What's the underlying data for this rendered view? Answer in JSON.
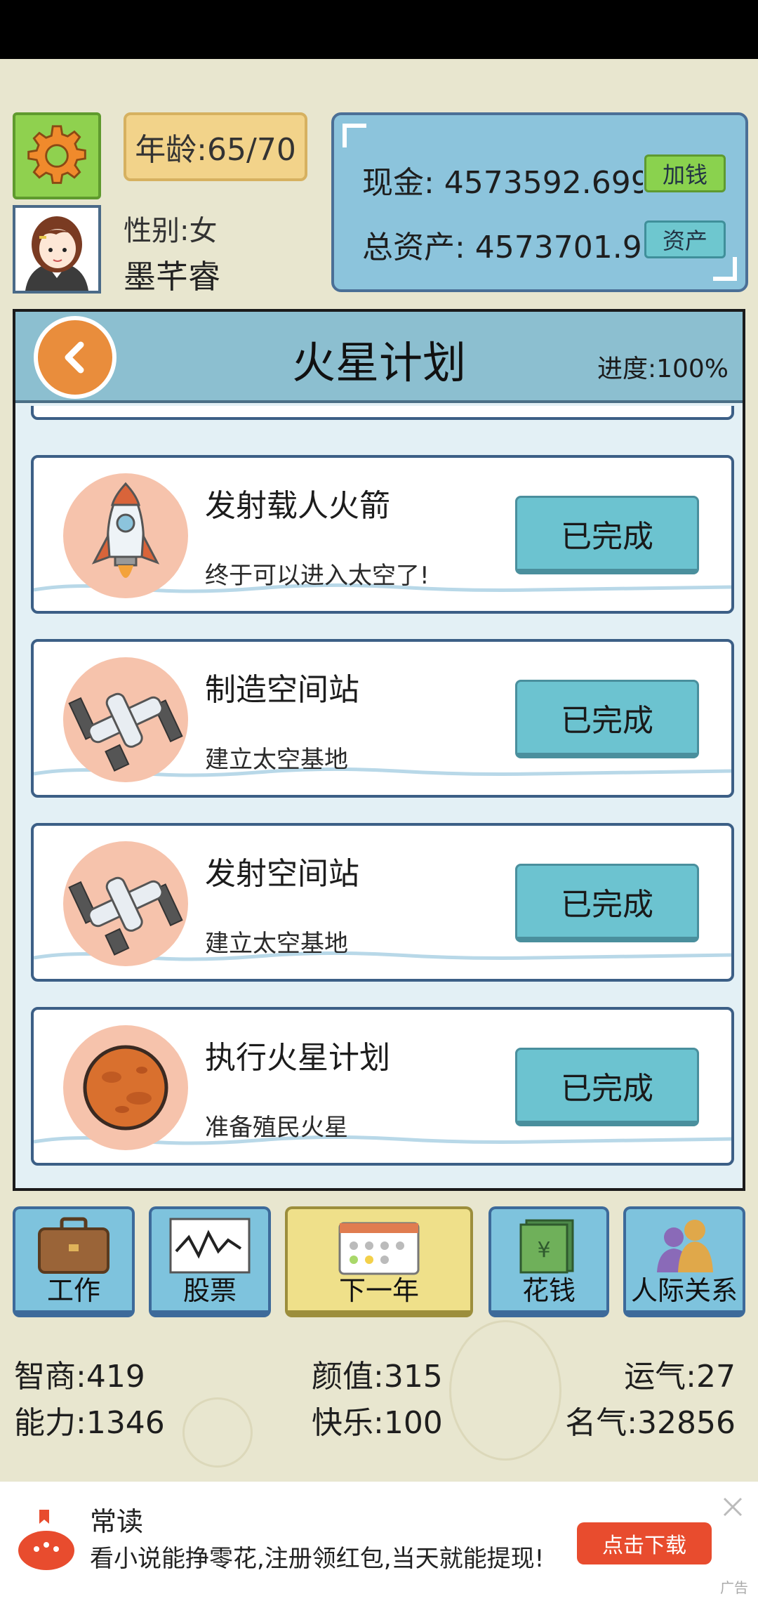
{
  "age": {
    "label": "年龄:65/70"
  },
  "profile": {
    "gender": "性别:女",
    "name": "墨芊睿"
  },
  "money": {
    "cash_label": "现金: 4573592.699",
    "add_money_button": "加钱",
    "assets_label": "总资产: 4573701.91",
    "assets_button": "资产"
  },
  "panel": {
    "title": "火星计划",
    "progress": "进度:100%"
  },
  "tasks": [
    {
      "title": "发射载人火箭",
      "desc": "终于可以进入太空了!",
      "status": "已完成",
      "icon": "rocket-icon"
    },
    {
      "title": "制造空间站",
      "desc": "建立太空基地",
      "status": "已完成",
      "icon": "space-station-icon"
    },
    {
      "title": "发射空间站",
      "desc": "建立太空基地",
      "status": "已完成",
      "icon": "space-station-icon"
    },
    {
      "title": "执行火星计划",
      "desc": "准备殖民火星",
      "status": "已完成",
      "icon": "mars-icon"
    }
  ],
  "nav": {
    "work": "工作",
    "stocks": "股票",
    "next_year": "下一年",
    "spend": "花钱",
    "relations": "人际关系"
  },
  "stats": {
    "iq": "智商:419",
    "looks": "颜值:315",
    "luck": "运气:27",
    "ability": "能力:1346",
    "happiness": "快乐:100",
    "fame": "名气:32856"
  },
  "ad": {
    "title": "常读",
    "text": "看小说能挣零花,注册领红包,当天就能提现!",
    "button": "点击下载",
    "tag": "广告"
  },
  "colors": {
    "panel_bg": "#e3f0f5",
    "header_bg": "#8cbfd0",
    "done_button": "#6cc3d0",
    "background": "#e8e6cf"
  }
}
